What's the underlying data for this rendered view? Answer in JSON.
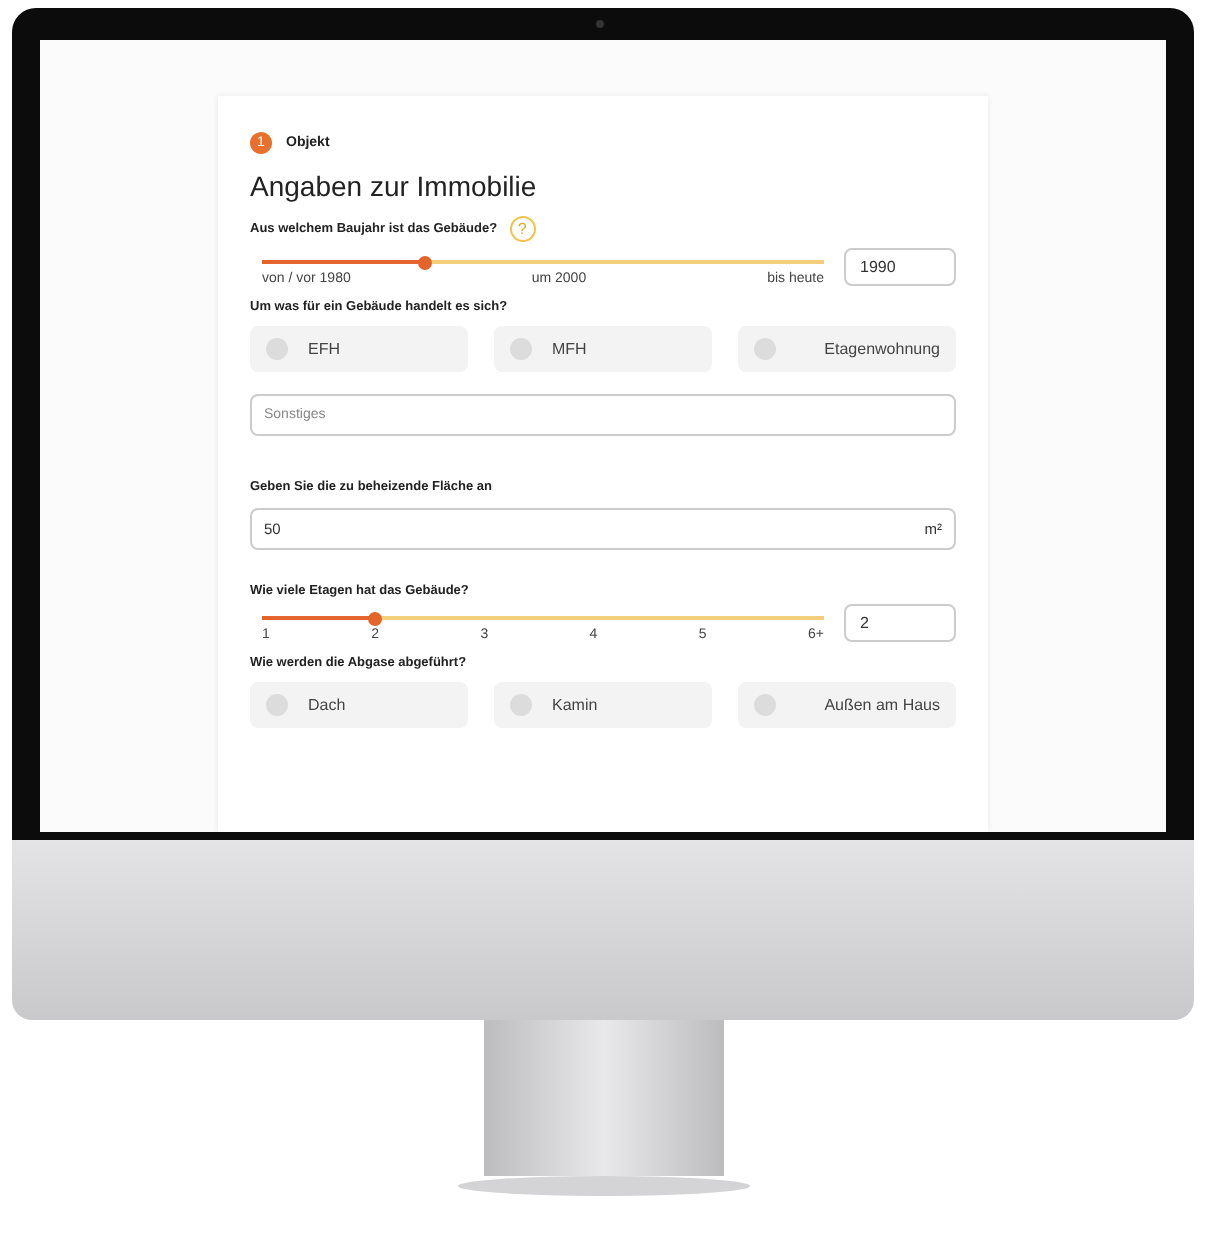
{
  "step": {
    "number": "1",
    "label": "Objekt"
  },
  "title": "Angaben zur Immobilie",
  "fields": [
    {
      "kind": "slider",
      "question": "Aus welchem Baujahr ist das Gebäude?",
      "help": "?",
      "level": 0.29,
      "ticks": [
        "von / vor 1980",
        "um 2000",
        "bis heute"
      ],
      "value": "1990"
    },
    {
      "kind": "choices",
      "question": "Um was für ein Gebäude handelt es sich?",
      "options": [
        {
          "label": "EFH",
          "selected": false
        },
        {
          "label": "MFH",
          "selected": false
        },
        {
          "label": "Etagenwohnung",
          "selected": false
        }
      ],
      "other_placeholder": "Sonstiges"
    },
    {
      "kind": "unit",
      "question": "Geben Sie die zu beheizende Fläche an",
      "value": "50",
      "unit": "m²"
    },
    {
      "kind": "slider",
      "question": "Wie viele Etagen hat das Gebäude?",
      "level": 0.2,
      "ticks": [
        "1",
        "2",
        "3",
        "4",
        "5",
        "6+"
      ],
      "value": "2"
    },
    {
      "kind": "choices",
      "question": "Wie werden die Abgase abgeführt?",
      "options": [
        {
          "label": "Dach",
          "selected": false
        },
        {
          "label": "Kamin",
          "selected": false
        },
        {
          "label": "Außen am Haus",
          "selected": false
        }
      ]
    }
  ]
}
